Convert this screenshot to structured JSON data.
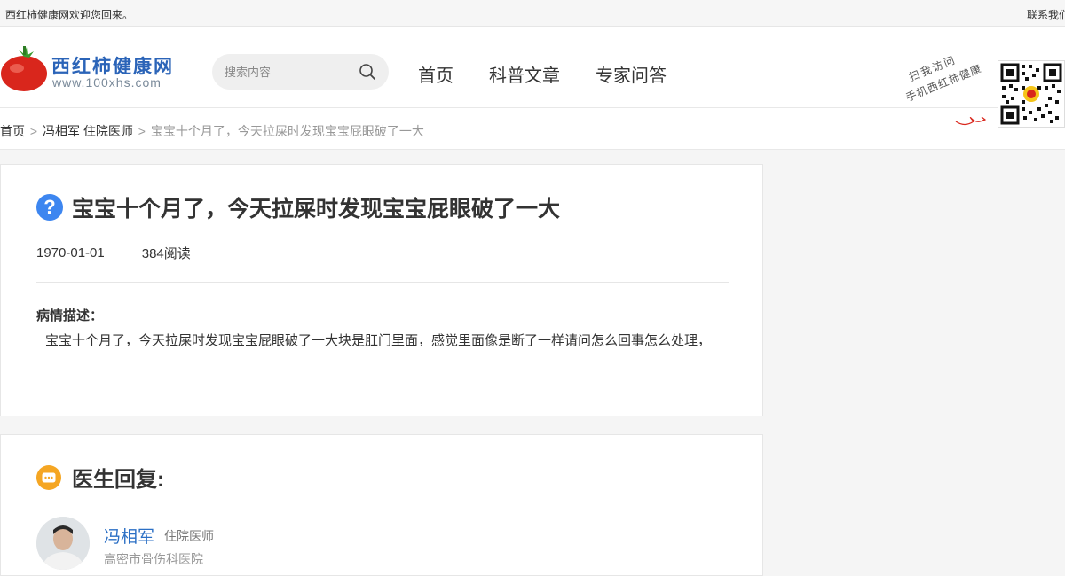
{
  "topbar": {
    "welcome": "西红柿健康网欢迎您回来。",
    "contact": "联系我们"
  },
  "logo": {
    "title": "西红柿健康网",
    "url": "www.100xhs.com"
  },
  "search": {
    "placeholder": "搜索内容",
    "icon": "search-icon"
  },
  "nav": {
    "items": [
      "首页",
      "科普文章",
      "专家问答"
    ]
  },
  "qr": {
    "line1": "扫我访问",
    "line2": "手机西红柿健康"
  },
  "breadcrumb": {
    "home": "首页",
    "sep": ">",
    "doctor": "冯相军 住院医师",
    "current": "宝宝十个月了，今天拉屎时发现宝宝屁眼破了一大"
  },
  "question": {
    "icon": "question-icon",
    "icon_char": "?",
    "title": "宝宝十个月了，今天拉屎时发现宝宝屁眼破了一大",
    "date": "1970-01-01",
    "reads": "384阅读",
    "desc_label": "病情描述：",
    "desc_text": "宝宝十个月了，今天拉屎时发现宝宝屁眼破了一大块是肛门里面，感觉里面像是断了一样请问怎么回事怎么处理，"
  },
  "answer": {
    "icon": "chat-icon",
    "title": "医生回复:",
    "doctor_name": "冯相军",
    "doctor_title": "住院医师",
    "hospital": "高密市骨伤科医院"
  },
  "colors": {
    "brand_blue": "#2b64b8",
    "question_icon": "#3d86f0",
    "answer_icon": "#f5a623",
    "doctor_name": "#2b6fc5",
    "tomato_red": "#d9261c"
  }
}
